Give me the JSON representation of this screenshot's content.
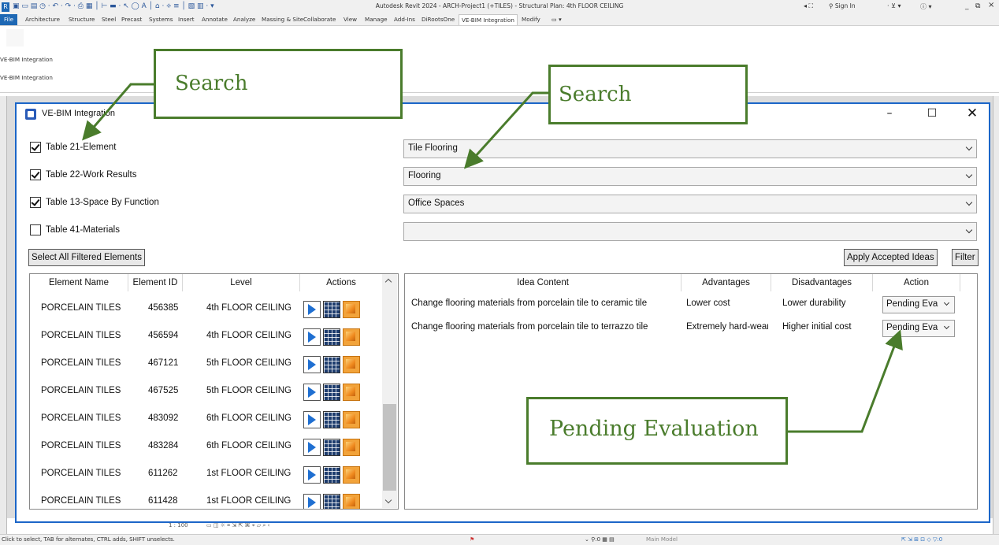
{
  "window": {
    "title": "Autodesk Revit 2024 - ARCH-Project1 (+TILES) - Structural Plan: 4th FLOOR CEILING",
    "sign_in": "Sign In",
    "controls": "_ ̅ ×"
  },
  "menu": [
    "File",
    "Architecture",
    "Structure",
    "Steel",
    "Precast",
    "Systems",
    "Insert",
    "Annotate",
    "Analyze",
    "Massing & Site",
    "Collaborate",
    "View",
    "Manage",
    "Add-Ins",
    "DiRootsOne",
    "VE-BIM Integration",
    "Modify"
  ],
  "menu_selected_index": 15,
  "ribbon": {
    "panel_label_1": "VE-BIM Integration",
    "panel_label_2": "VE-BIM Integration"
  },
  "status": {
    "hint": "Click to select, TAB for alternates, CTRL adds, SHIFT unselects.",
    "scale": "1 : 100",
    "model": "Main Model"
  },
  "dialog": {
    "title": "VE-BIM Integration",
    "filters": [
      {
        "label": "Table 21-Element",
        "checked": true
      },
      {
        "label": "Table 22-Work Results",
        "checked": true
      },
      {
        "label": "Table 13-Space By Function",
        "checked": true
      },
      {
        "label": "Table 41-Materials",
        "checked": false
      }
    ],
    "combos": [
      "Tile Flooring",
      "Flooring",
      "Office Spaces",
      ""
    ],
    "select_all_label": "Select All Filtered Elements",
    "apply_label": "Apply Accepted Ideas",
    "filter_label": "Filter",
    "elements_columns": [
      "Element Name",
      "Element ID",
      "Level",
      "Actions"
    ],
    "elements": [
      {
        "name": "PORCELAIN TILES",
        "id": "456385",
        "level": "4th FLOOR CEILING"
      },
      {
        "name": "PORCELAIN TILES",
        "id": "456594",
        "level": "4th FLOOR CEILING"
      },
      {
        "name": "PORCELAIN TILES",
        "id": "467121",
        "level": "5th FLOOR CEILING"
      },
      {
        "name": "PORCELAIN TILES",
        "id": "467525",
        "level": "5th FLOOR CEILING"
      },
      {
        "name": "PORCELAIN TILES",
        "id": "483092",
        "level": "6th FLOOR CEILING"
      },
      {
        "name": "PORCELAIN TILES",
        "id": "483284",
        "level": "6th FLOOR CEILING"
      },
      {
        "name": "PORCELAIN TILES",
        "id": "611262",
        "level": "1st FLOOR CEILING"
      },
      {
        "name": "PORCELAIN TILES",
        "id": "611428",
        "level": "1st FLOOR CEILING"
      }
    ],
    "action_icons": [
      "select-element-icon",
      "schedule-grid-icon",
      "3d-box-icon"
    ],
    "ideas_columns": [
      "Idea Content",
      "Advantages",
      "Disadvantages",
      "Action"
    ],
    "ideas": [
      {
        "content": "Change flooring materials from porcelain tile to ceramic tile",
        "advantages": "Lower cost",
        "disadvantages": "Lower durability",
        "action": "Pending Evaluation"
      },
      {
        "content": "Change flooring materials from porcelain tile to terrazzo tile",
        "advantages": "Extremely hard-wearing",
        "disadvantages": "Higher initial cost",
        "action": "Pending Evaluation"
      }
    ]
  },
  "callouts": {
    "search_left": "Search",
    "search_right": "Search",
    "pending": "Pending Evaluation",
    "color": "#4a7c2c"
  }
}
